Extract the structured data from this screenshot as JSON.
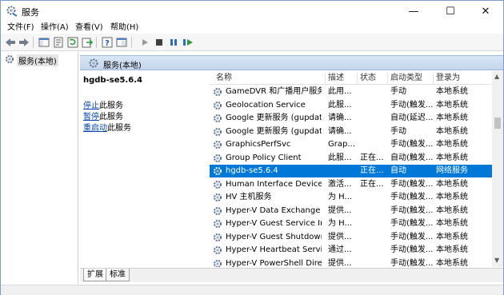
{
  "window": {
    "title": "服务"
  },
  "controls": {
    "minimize": "—",
    "maximize": "☐",
    "close": "✕"
  },
  "menu": [
    {
      "label": "文件(F)"
    },
    {
      "label": "操作(A)"
    },
    {
      "label": "查看(V)"
    },
    {
      "label": "帮助(H)"
    }
  ],
  "tree": {
    "root_label": "服务(本地)"
  },
  "panel": {
    "header_label": "服务(本地)"
  },
  "detail": {
    "service_title": "hgdb-se5.6.4",
    "actions": [
      {
        "link": "停止",
        "rest": "此服务"
      },
      {
        "link": "暂停",
        "rest": "此服务"
      },
      {
        "link": "重启动",
        "rest": "此服务"
      }
    ]
  },
  "grid": {
    "columns": [
      "名称",
      "描述",
      "状态",
      "启动类型",
      "登录为"
    ],
    "rows": [
      {
        "name": "GameDVR 和广播用户服务...",
        "desc": "此用...",
        "state": "",
        "startup": "手动",
        "logon": "本地系统"
      },
      {
        "name": "Geolocation Service",
        "desc": "此服...",
        "state": "",
        "startup": "手动(触发...",
        "logon": "本地系统"
      },
      {
        "name": "Google 更新服务 (gupdate)",
        "desc": "请确...",
        "state": "",
        "startup": "自动(延迟...",
        "logon": "本地系统"
      },
      {
        "name": "Google 更新服务 (gupdate...",
        "desc": "请确...",
        "state": "",
        "startup": "手动",
        "logon": "本地系统"
      },
      {
        "name": "GraphicsPerfSvc",
        "desc": "Grap...",
        "state": "",
        "startup": "手动(触发...",
        "logon": "本地系统"
      },
      {
        "name": "Group Policy Client",
        "desc": "此服...",
        "state": "正在...",
        "startup": "自动(触发...",
        "logon": "本地系统"
      },
      {
        "name": "hgdb-se5.6.4",
        "desc": "",
        "state": "正在...",
        "startup": "自动",
        "logon": "网络服务"
      },
      {
        "name": "Human Interface Device S...",
        "desc": "激活...",
        "state": "正在...",
        "startup": "手动(触发...",
        "logon": "本地系统"
      },
      {
        "name": "HV 主机服务",
        "desc": "为 H...",
        "state": "",
        "startup": "手动(触发...",
        "logon": "本地系统"
      },
      {
        "name": "Hyper-V Data Exchange Se...",
        "desc": "提供...",
        "state": "",
        "startup": "手动(触发...",
        "logon": "本地系统"
      },
      {
        "name": "Hyper-V Guest Service Int...",
        "desc": "为 H...",
        "state": "",
        "startup": "手动(触发...",
        "logon": "本地系统"
      },
      {
        "name": "Hyper-V Guest Shutdown ...",
        "desc": "提供...",
        "state": "",
        "startup": "手动(触发...",
        "logon": "本地系统"
      },
      {
        "name": "Hyper-V Heartbeat Service",
        "desc": "通过...",
        "state": "",
        "startup": "手动(触发...",
        "logon": "本地系统"
      },
      {
        "name": "Hyper-V PowerShell Direct...",
        "desc": "提供...",
        "state": "",
        "startup": "手动(触发...",
        "logon": "本地系统"
      }
    ],
    "selected_index": 6
  },
  "tabs": [
    {
      "label": "扩展"
    },
    {
      "label": "标准"
    }
  ],
  "colors": {
    "accent": "#0078d7",
    "link": "#0645ad"
  },
  "icons": [
    "back-icon",
    "forward-icon",
    "show-tree-icon",
    "properties-icon",
    "refresh-icon",
    "export-icon",
    "help-icon",
    "console-icon",
    "play-icon",
    "stop-icon",
    "pause-icon",
    "restart-icon",
    "gear-icon"
  ]
}
